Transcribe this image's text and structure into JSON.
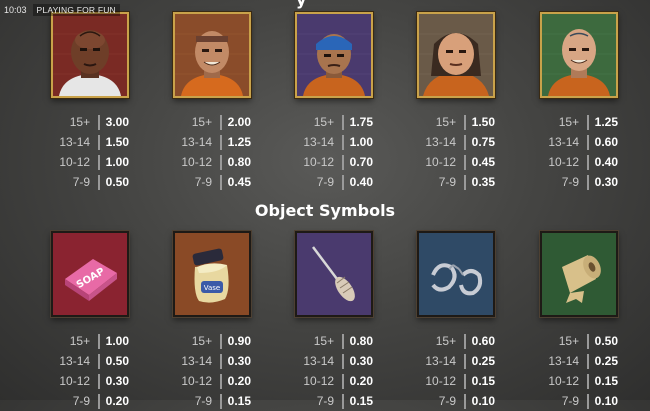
{
  "status": {
    "time": "10:03",
    "mode": "PLAYING FOR FUN"
  },
  "top_section_title_fragment": "y",
  "object_section_title": "Object Symbols",
  "character_symbols": [
    {
      "name": "skull-tattoo-prisoner",
      "pays": [
        [
          "15+",
          "3.00"
        ],
        [
          "13-14",
          "1.50"
        ],
        [
          "10-12",
          "1.00"
        ],
        [
          "7-9",
          "0.50"
        ]
      ],
      "bg": "#8a2f2a"
    },
    {
      "name": "headband-grin-prisoner",
      "pays": [
        [
          "15+",
          "2.00"
        ],
        [
          "13-14",
          "1.25"
        ],
        [
          "10-12",
          "0.80"
        ],
        [
          "7-9",
          "0.45"
        ]
      ],
      "bg": "#8a4a26"
    },
    {
      "name": "bandana-prisoner",
      "pays": [
        [
          "15+",
          "1.75"
        ],
        [
          "13-14",
          "1.00"
        ],
        [
          "10-12",
          "0.70"
        ],
        [
          "7-9",
          "0.40"
        ]
      ],
      "bg": "#4a3a6e"
    },
    {
      "name": "long-hair-prisoner",
      "pays": [
        [
          "15+",
          "1.50"
        ],
        [
          "13-14",
          "0.75"
        ],
        [
          "10-12",
          "0.45"
        ],
        [
          "7-9",
          "0.35"
        ]
      ],
      "bg": "#6a5a48"
    },
    {
      "name": "lucky-tattoo-prisoner",
      "pays": [
        [
          "15+",
          "1.25"
        ],
        [
          "13-14",
          "0.60"
        ],
        [
          "10-12",
          "0.40"
        ],
        [
          "7-9",
          "0.30"
        ]
      ],
      "bg": "#3d6a3e"
    }
  ],
  "object_symbols": [
    {
      "name": "soap-icon",
      "label": "SOAP",
      "pays": [
        [
          "15+",
          "1.00"
        ],
        [
          "13-14",
          "0.50"
        ],
        [
          "10-12",
          "0.30"
        ],
        [
          "7-9",
          "0.20"
        ]
      ],
      "bg": "#8a2330"
    },
    {
      "name": "vaseline-jar-icon",
      "label": "Vase",
      "pays": [
        [
          "15+",
          "0.90"
        ],
        [
          "13-14",
          "0.30"
        ],
        [
          "10-12",
          "0.20"
        ],
        [
          "7-9",
          "0.15"
        ]
      ],
      "bg": "#8a4a26"
    },
    {
      "name": "shiv-icon",
      "pays": [
        [
          "15+",
          "0.80"
        ],
        [
          "13-14",
          "0.30"
        ],
        [
          "10-12",
          "0.20"
        ],
        [
          "7-9",
          "0.15"
        ]
      ],
      "bg": "#4a3a6e"
    },
    {
      "name": "handcuffs-icon",
      "pays": [
        [
          "15+",
          "0.60"
        ],
        [
          "13-14",
          "0.25"
        ],
        [
          "10-12",
          "0.15"
        ],
        [
          "7-9",
          "0.10"
        ]
      ],
      "bg": "#2f4a66"
    },
    {
      "name": "toilet-roll-icon",
      "pays": [
        [
          "15+",
          "0.50"
        ],
        [
          "13-14",
          "0.25"
        ],
        [
          "10-12",
          "0.15"
        ],
        [
          "7-9",
          "0.10"
        ]
      ],
      "bg": "#2f5a34"
    }
  ]
}
